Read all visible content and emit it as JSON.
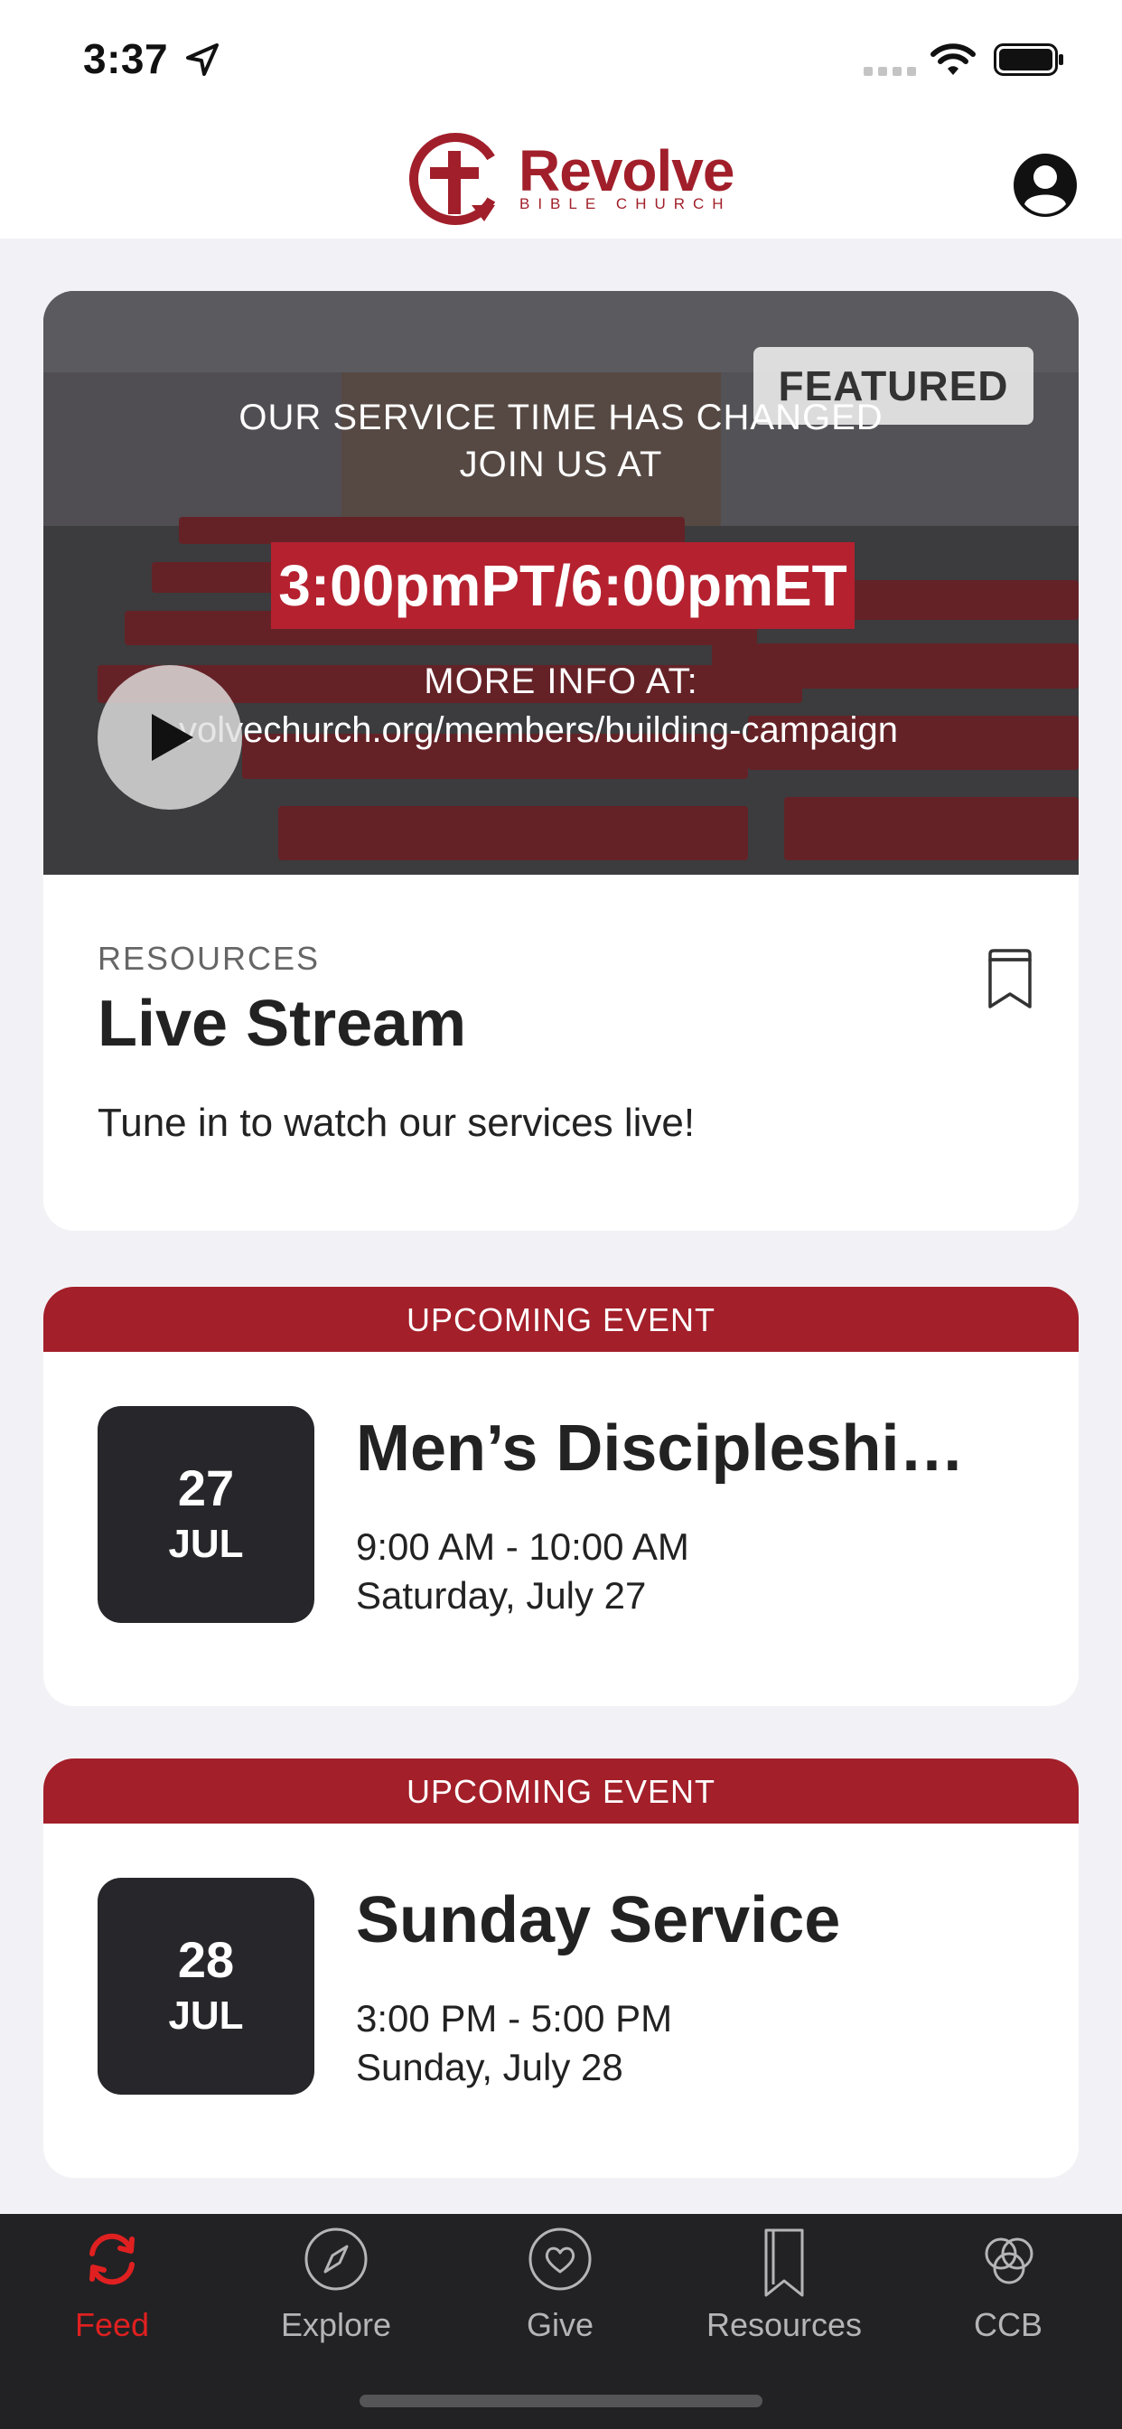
{
  "status_bar": {
    "time": "3:37"
  },
  "header": {
    "logo_name": "Revolve",
    "logo_subtitle": "BIBLE CHURCH",
    "brand_color": "#a11f2a"
  },
  "featured": {
    "badge": "FEATURED",
    "hero_line1": "OUR SERVICE TIME HAS CHANGED",
    "hero_line2": "JOIN US AT",
    "hero_time": "3:00pmPT/6:00pmET",
    "hero_line3": "MORE INFO AT:",
    "hero_line4": "volvechurch.org/members/building-campaign",
    "eyebrow": "RESOURCES",
    "title": "Live Stream",
    "description": "Tune in to watch our services live!"
  },
  "events": [
    {
      "banner": "UPCOMING EVENT",
      "day": "27",
      "month": "JUL",
      "title": "Men’s Discipleshi…",
      "time": "9:00 AM - 10:00 AM",
      "date": "Saturday, July 27"
    },
    {
      "banner": "UPCOMING EVENT",
      "day": "28",
      "month": "JUL",
      "title": "Sunday Service",
      "time": "3:00 PM - 5:00 PM",
      "date": "Sunday, July 28"
    }
  ],
  "tabs": [
    {
      "label": "Feed",
      "icon": "feed-icon",
      "active": true
    },
    {
      "label": "Explore",
      "icon": "compass-icon",
      "active": false
    },
    {
      "label": "Give",
      "icon": "heart-icon",
      "active": false
    },
    {
      "label": "Resources",
      "icon": "bookmark-icon",
      "active": false
    },
    {
      "label": "CCB",
      "icon": "circles-icon",
      "active": false
    }
  ],
  "colors": {
    "event_banner": "#a31f2a",
    "active_tab": "#e02020",
    "tab_bar": "#222224",
    "date_box": "#27272b"
  }
}
